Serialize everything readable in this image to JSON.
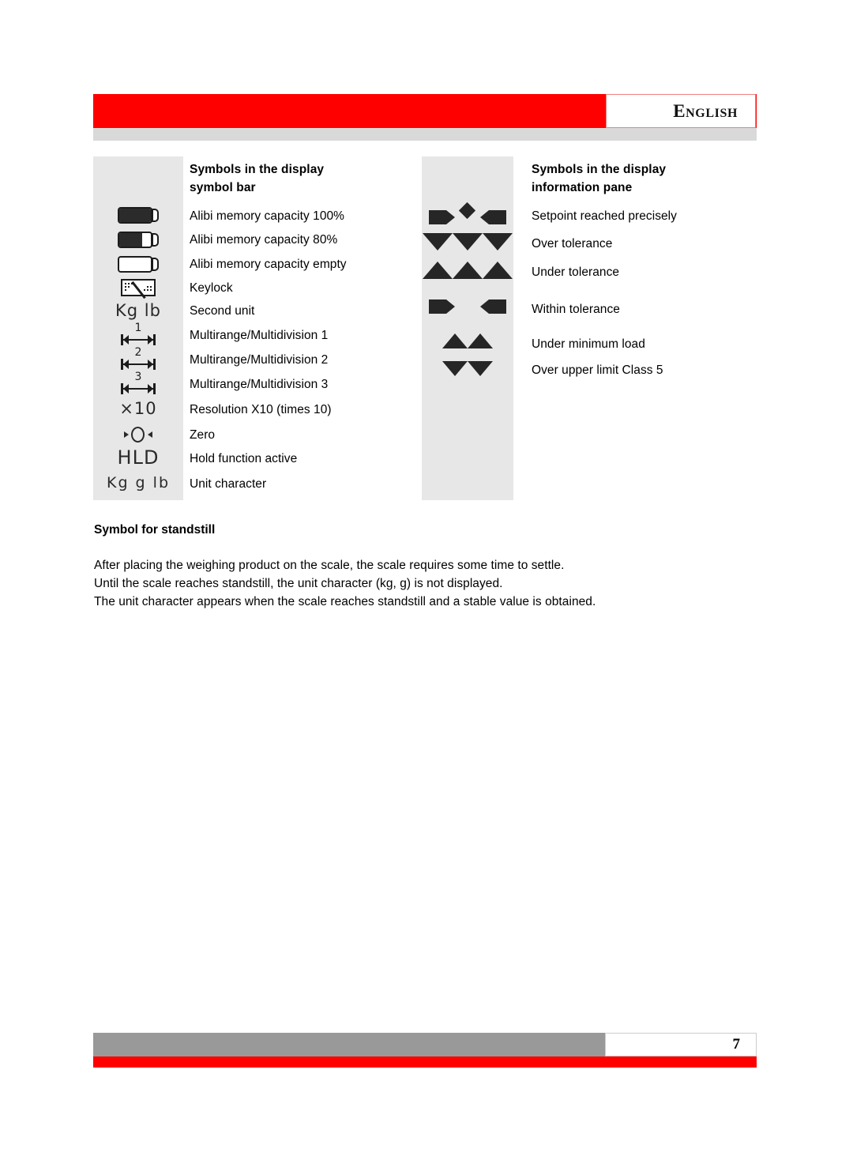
{
  "header": {
    "language_label": "English",
    "red_bar_color": "#fe0000",
    "gray_band_color": "#d9d9d9"
  },
  "symbol_bar_table": {
    "heading_line1": "Symbols in the display",
    "heading_line2": "symbol bar",
    "rows": [
      {
        "icon": "battery-full-icon",
        "label": "Alibi memory capacity 100%"
      },
      {
        "icon": "battery-80-icon",
        "label": "Alibi memory capacity 80%"
      },
      {
        "icon": "battery-empty-icon",
        "label": "Alibi memory capacity empty"
      },
      {
        "icon": "keylock-icon",
        "label": "Keylock"
      },
      {
        "icon": "second-unit-icon",
        "label": "Second unit",
        "glyph": "Kg lb"
      },
      {
        "icon": "multirange-1-icon",
        "label": "Multirange/Multidivision 1",
        "glyph": "1"
      },
      {
        "icon": "multirange-2-icon",
        "label": "Multirange/Multidivision 2",
        "glyph": "2"
      },
      {
        "icon": "multirange-3-icon",
        "label": "Multirange/Multidivision 3",
        "glyph": "3"
      },
      {
        "icon": "resolution-x10-icon",
        "label": "Resolution X10 (times 10)",
        "glyph": "×10"
      },
      {
        "icon": "zero-icon",
        "label": "Zero"
      },
      {
        "icon": "hold-icon",
        "label": "Hold function active",
        "glyph": "HLD"
      },
      {
        "icon": "unit-character-icon",
        "label": "Unit character",
        "glyph": "Kg  g  lb"
      }
    ]
  },
  "information_pane_table": {
    "heading_line1": "Symbols in the display",
    "heading_line2": "information pane",
    "rows": [
      {
        "icon": "setpoint-reached-icon",
        "label": "Setpoint reached precisely"
      },
      {
        "icon": "over-tolerance-icon",
        "label": "Over tolerance"
      },
      {
        "icon": "under-tolerance-icon",
        "label": "Under tolerance"
      },
      {
        "icon": "within-tolerance-icon",
        "label": "Within tolerance"
      },
      {
        "icon": "under-minimum-load-icon",
        "label": "Under minimum load"
      },
      {
        "icon": "over-upper-limit-icon",
        "label": "Over upper limit Class 5"
      }
    ]
  },
  "standstill_section": {
    "heading": "Symbol for standstill",
    "paragraph_lines": [
      "After placing the weighing product on the scale, the scale requires some time to settle.",
      "Until the scale reaches standstill, the unit character (kg, g) is not displayed.",
      "The unit character appears when the scale reaches standstill and a stable value is obtained."
    ]
  },
  "footer": {
    "page_number": "7",
    "gray_bar_color": "#999999",
    "red_bar_color": "#fe0000"
  }
}
